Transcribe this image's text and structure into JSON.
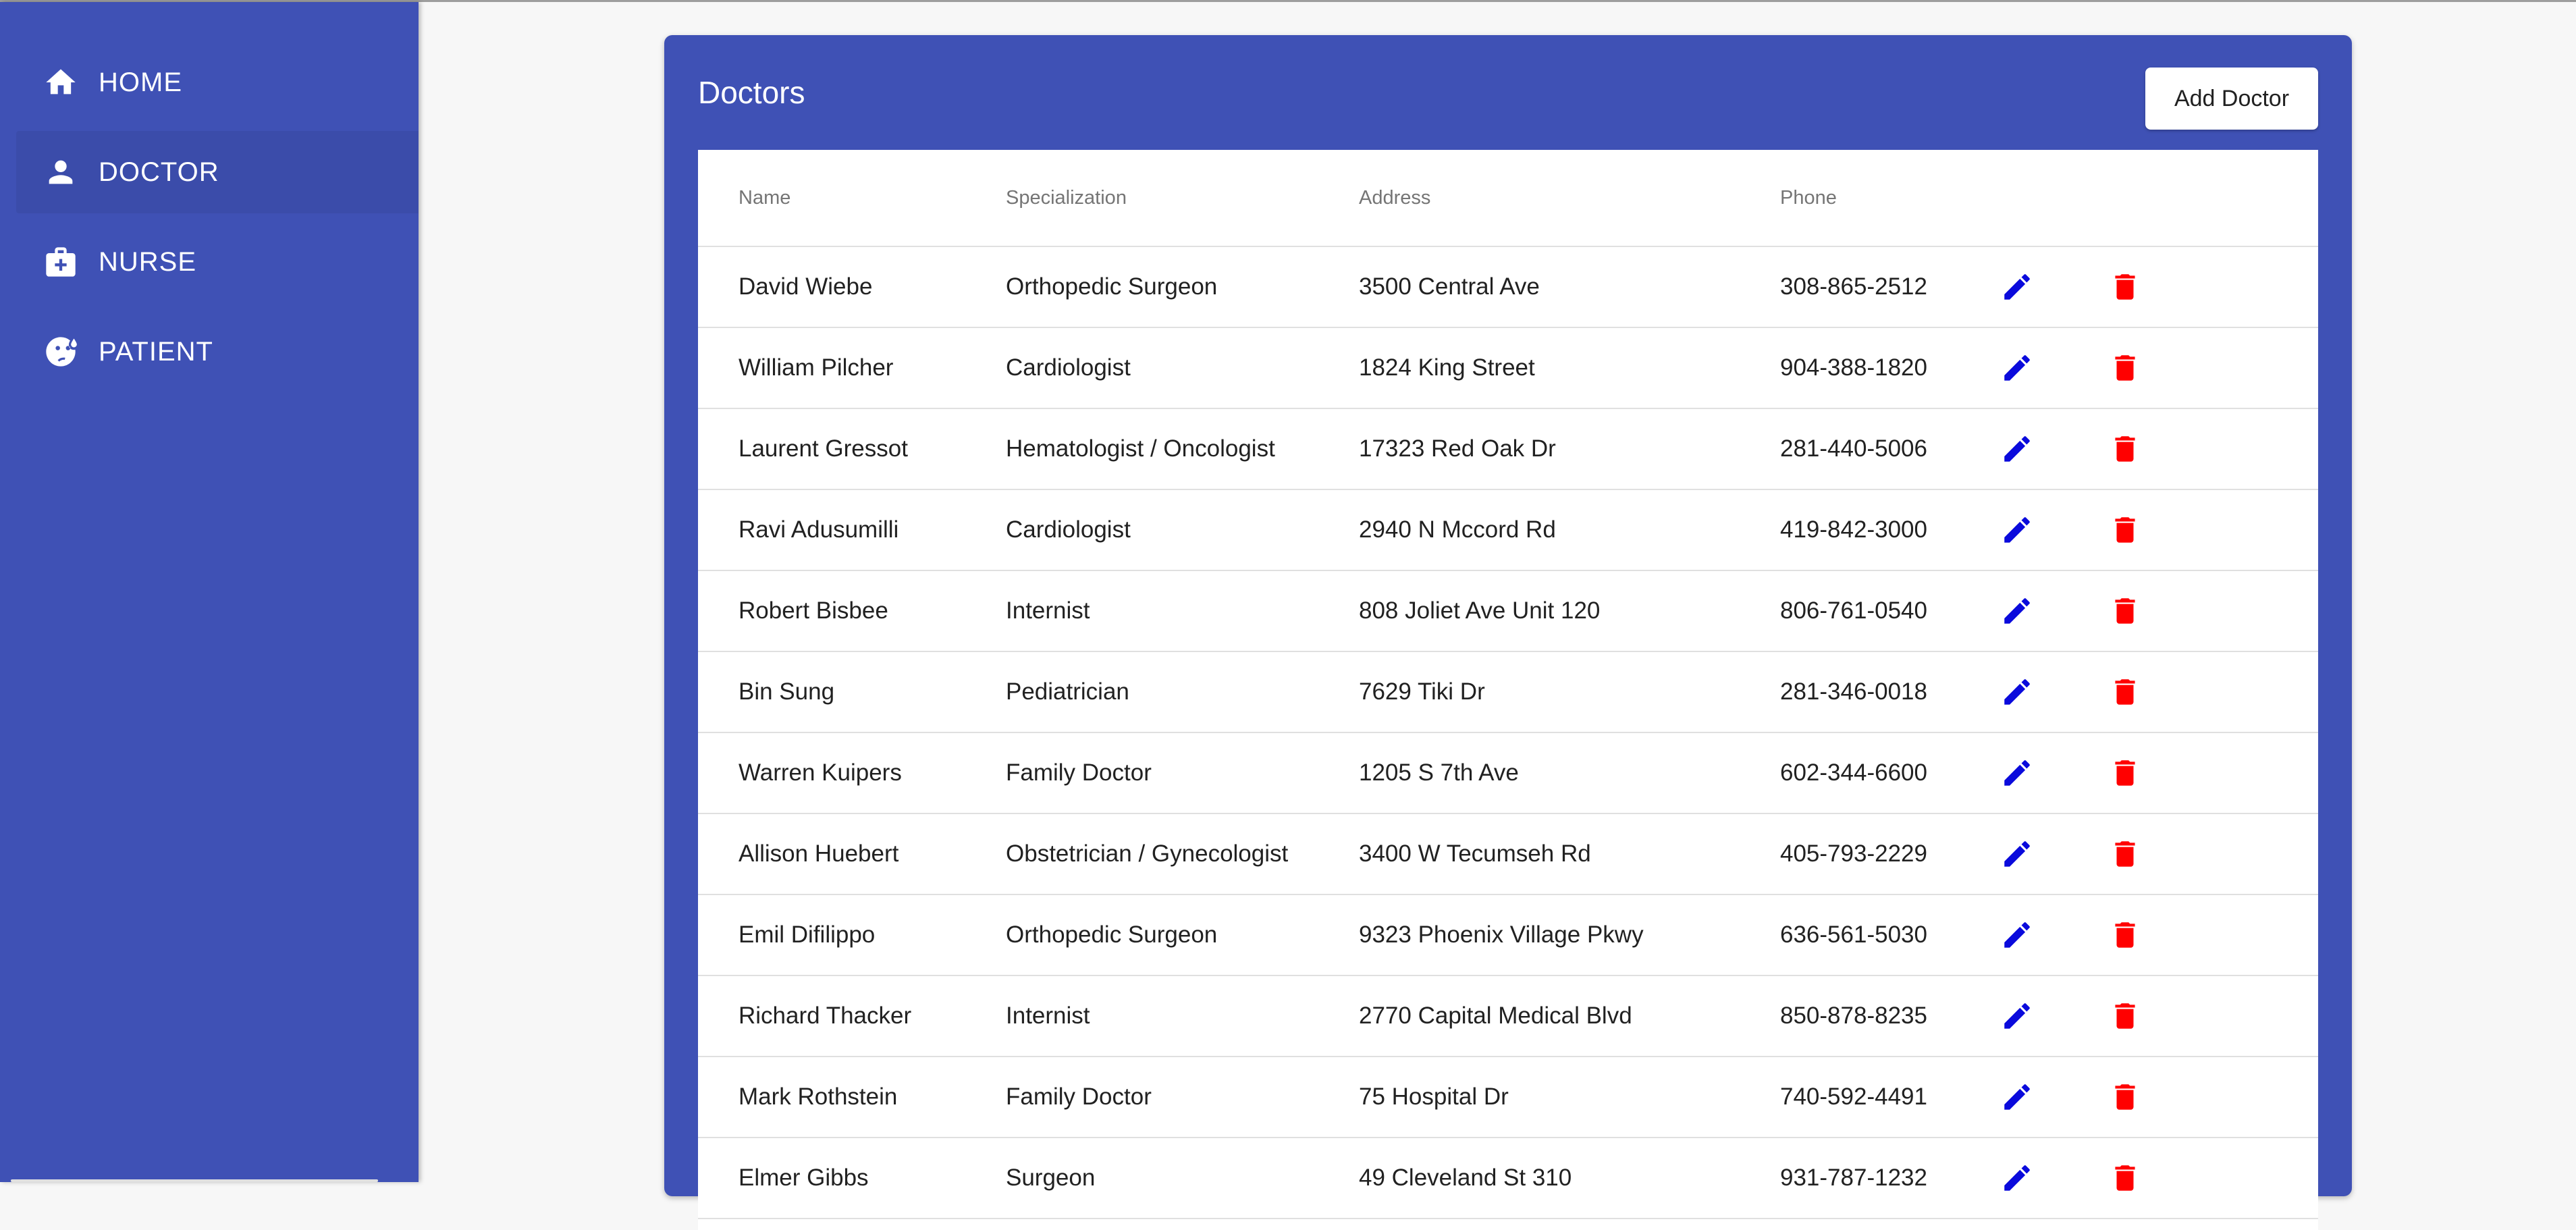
{
  "sidebar": {
    "items": [
      {
        "label": "HOME",
        "icon": "home-icon"
      },
      {
        "label": "DOCTOR",
        "icon": "person-icon",
        "active": true
      },
      {
        "label": "NURSE",
        "icon": "medical-bag-icon"
      },
      {
        "label": "PATIENT",
        "icon": "sick-face-icon"
      }
    ]
  },
  "main": {
    "title": "Doctors",
    "add_button_label": "Add Doctor",
    "columns": [
      "Name",
      "Specialization",
      "Address",
      "Phone"
    ],
    "rows": [
      {
        "name": "David Wiebe",
        "specialization": "Orthopedic Surgeon",
        "address": "3500 Central Ave",
        "phone": "308-865-2512"
      },
      {
        "name": "William Pilcher",
        "specialization": "Cardiologist",
        "address": "1824 King Street",
        "phone": "904-388-1820"
      },
      {
        "name": "Laurent Gressot",
        "specialization": "Hematologist / Oncologist",
        "address": "17323 Red Oak Dr",
        "phone": "281-440-5006"
      },
      {
        "name": "Ravi Adusumilli",
        "specialization": "Cardiologist",
        "address": "2940 N Mccord Rd",
        "phone": "419-842-3000"
      },
      {
        "name": "Robert Bisbee",
        "specialization": "Internist",
        "address": "808 Joliet Ave Unit 120",
        "phone": "806-761-0540"
      },
      {
        "name": "Bin Sung",
        "specialization": "Pediatrician",
        "address": "7629 Tiki Dr",
        "phone": "281-346-0018"
      },
      {
        "name": "Warren Kuipers",
        "specialization": "Family Doctor",
        "address": "1205 S 7th Ave",
        "phone": "602-344-6600"
      },
      {
        "name": "Allison Huebert",
        "specialization": "Obstetrician / Gynecologist",
        "address": "3400 W Tecumseh Rd",
        "phone": "405-793-2229"
      },
      {
        "name": "Emil Difilippo",
        "specialization": "Orthopedic Surgeon",
        "address": "9323 Phoenix Village Pkwy",
        "phone": "636-561-5030"
      },
      {
        "name": "Richard Thacker",
        "specialization": "Internist",
        "address": "2770 Capital Medical Blvd",
        "phone": "850-878-8235"
      },
      {
        "name": "Mark Rothstein",
        "specialization": "Family Doctor",
        "address": "75 Hospital Dr",
        "phone": "740-592-4491"
      },
      {
        "name": "Elmer Gibbs",
        "specialization": "Surgeon",
        "address": "49 Cleveland St 310",
        "phone": "931-787-1232"
      }
    ]
  },
  "colors": {
    "primary": "#3f51b5",
    "edit_icon": "#0a0adc",
    "delete_icon": "#ff0000"
  }
}
